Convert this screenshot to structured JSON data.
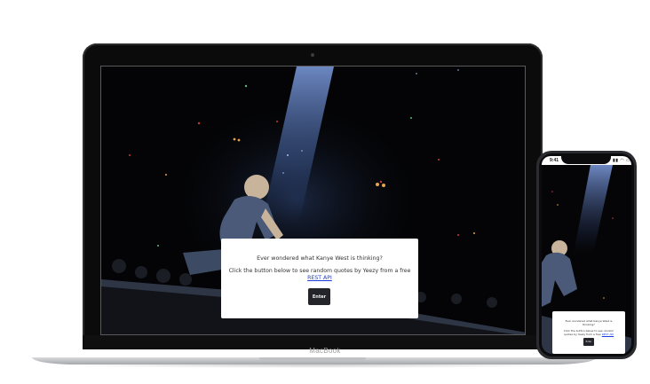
{
  "laptop": {
    "brand": "MacBook",
    "modal": {
      "heading": "Ever wondered what Kanye West is thinking?",
      "text_before_link": "Click the button below to see random quotes by Yeezy from a free ",
      "link_text": "REST API",
      "button_label": "Enter"
    }
  },
  "phone": {
    "status": {
      "time": "9:41",
      "icons": "▮▮ ◠ ▭"
    },
    "modal": {
      "heading": "Ever wondered what Kanye West is thinking?",
      "text_before_link": "Click the button below to see random quotes by Yeezy from a free ",
      "link_text": "REST API",
      "button_label": "Enter"
    }
  },
  "colors": {
    "stage_background": "#040406",
    "modal_background": "#ffffff",
    "button_background": "#23252b",
    "link": "#1a3cd8"
  }
}
